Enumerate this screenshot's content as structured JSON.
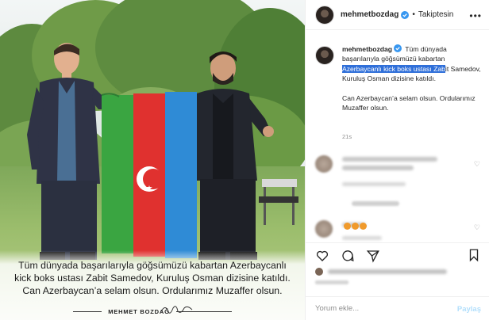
{
  "photo": {
    "caption_lines": [
      "Tüm dünyada başarılarıyla göğsümüzü kabartan Azerbaycanlı",
      "kick boks ustası  Zabit Samedov, Kuruluş Osman dizisine katıldı.",
      "Can Azerbaycan’a selam olsun. Ordularımız Muzaffer olsun."
    ],
    "footer_name": "MEHMET BOZDAĞ"
  },
  "header": {
    "username": "mehmetbozdag",
    "separator": "•",
    "follow_status": "Takiptesin",
    "more_icon": "more-dots-icon"
  },
  "post": {
    "username": "mehmetbozdag",
    "text_before": "Tüm dünyada başarılarıyla göğsümüzü kabartan",
    "text_highlight": "Azerbaycanlı kick boks ustası Zab",
    "text_after": "it Samedov, Kuruluş Osman dizisine katıldı.",
    "text_line2": "Can Azerbaycan’a selam olsun. Ordularımız Muzaffer olsun.",
    "time": "21s",
    "highlight_color": "#2f6fd9"
  },
  "actions": {
    "icons": [
      "heart-icon",
      "comment-icon",
      "share-icon",
      "bookmark-icon"
    ]
  },
  "comment_box": {
    "placeholder": "Yorum ekle...",
    "post_label": "Paylaş"
  },
  "colors": {
    "flag_blue": "#2f8bd6",
    "flag_red": "#e0312f",
    "flag_green": "#3aa541",
    "link_blue": "#b2dffc"
  }
}
